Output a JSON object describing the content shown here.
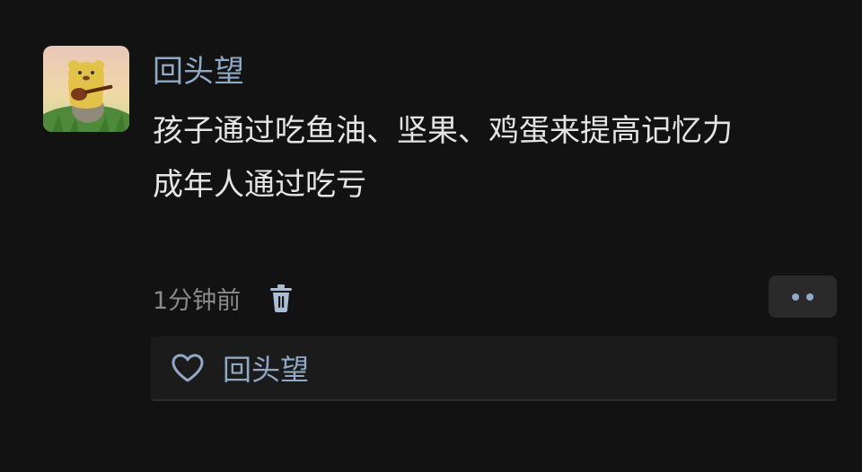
{
  "comment": {
    "user": {
      "name": "回头望"
    },
    "lines": [
      "孩子通过吃鱼油、坚果、鸡蛋来提高记忆力",
      "成年人通过吃亏"
    ],
    "time": "1分钟前"
  },
  "likes": {
    "users": [
      "回头望"
    ]
  },
  "icons": {
    "trash": "trash-icon",
    "more": "more-dots-icon",
    "heart": "heart-outline-icon"
  },
  "colors": {
    "background": "#121212",
    "username": "#8fa9c6",
    "text": "#e4e4e4",
    "muted": "#8a8a8a"
  }
}
